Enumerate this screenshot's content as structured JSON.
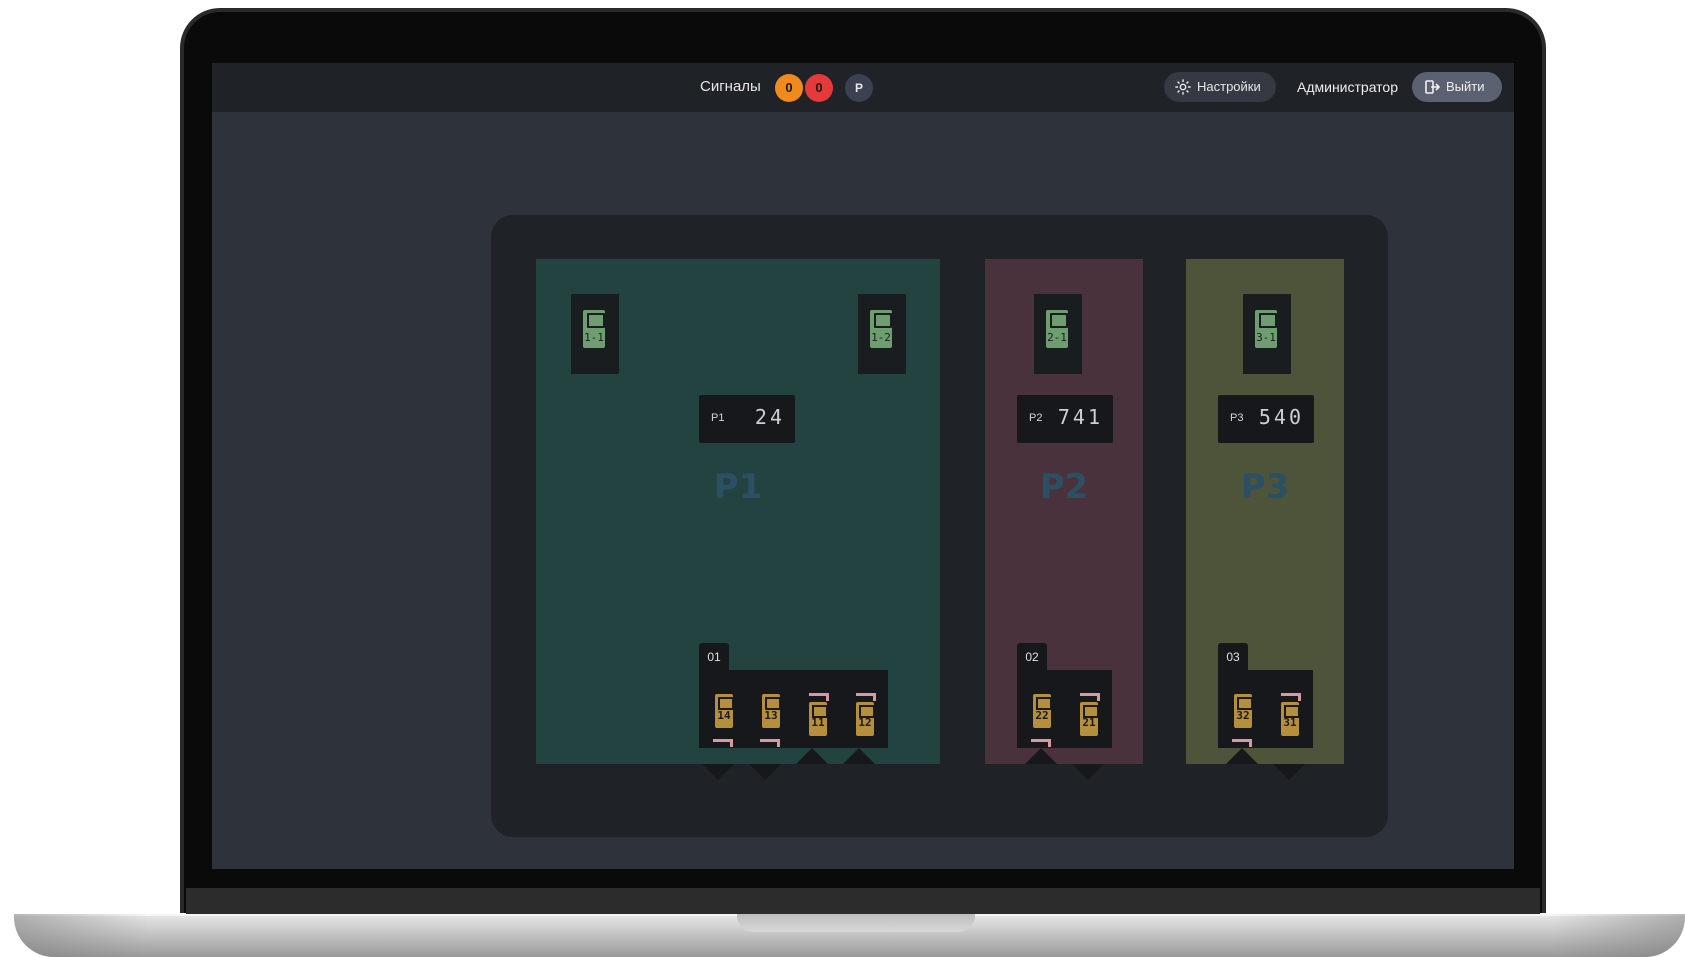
{
  "header": {
    "signals_label": "Сигналы",
    "signals_orange": "0",
    "signals_red": "0",
    "p_badge": "P",
    "settings_label": "Настройки",
    "user_label": "Администратор",
    "logout_label": "Выйти"
  },
  "colors": {
    "room_p1": "#234341",
    "room_p2": "#4a323c",
    "room_p3": "#4e543a",
    "badge_orange": "#f08a1c",
    "badge_red": "#e63a3a",
    "device_green": "#6e9e70",
    "camera_gold": "#b58f3b"
  },
  "rooms": [
    {
      "name": "P1",
      "sensors": [
        "1-1",
        "1-2"
      ],
      "readout": {
        "label": "P1",
        "value": "24"
      },
      "group": {
        "label": "01",
        "cameras": [
          "14",
          "13",
          "11",
          "12"
        ]
      }
    },
    {
      "name": "P2",
      "sensors": [
        "2-1"
      ],
      "readout": {
        "label": "P2",
        "value": "741"
      },
      "group": {
        "label": "02",
        "cameras": [
          "22",
          "21"
        ]
      }
    },
    {
      "name": "P3",
      "sensors": [
        "3-1"
      ],
      "readout": {
        "label": "P3",
        "value": "540"
      },
      "group": {
        "label": "03",
        "cameras": [
          "32",
          "31"
        ]
      }
    }
  ]
}
